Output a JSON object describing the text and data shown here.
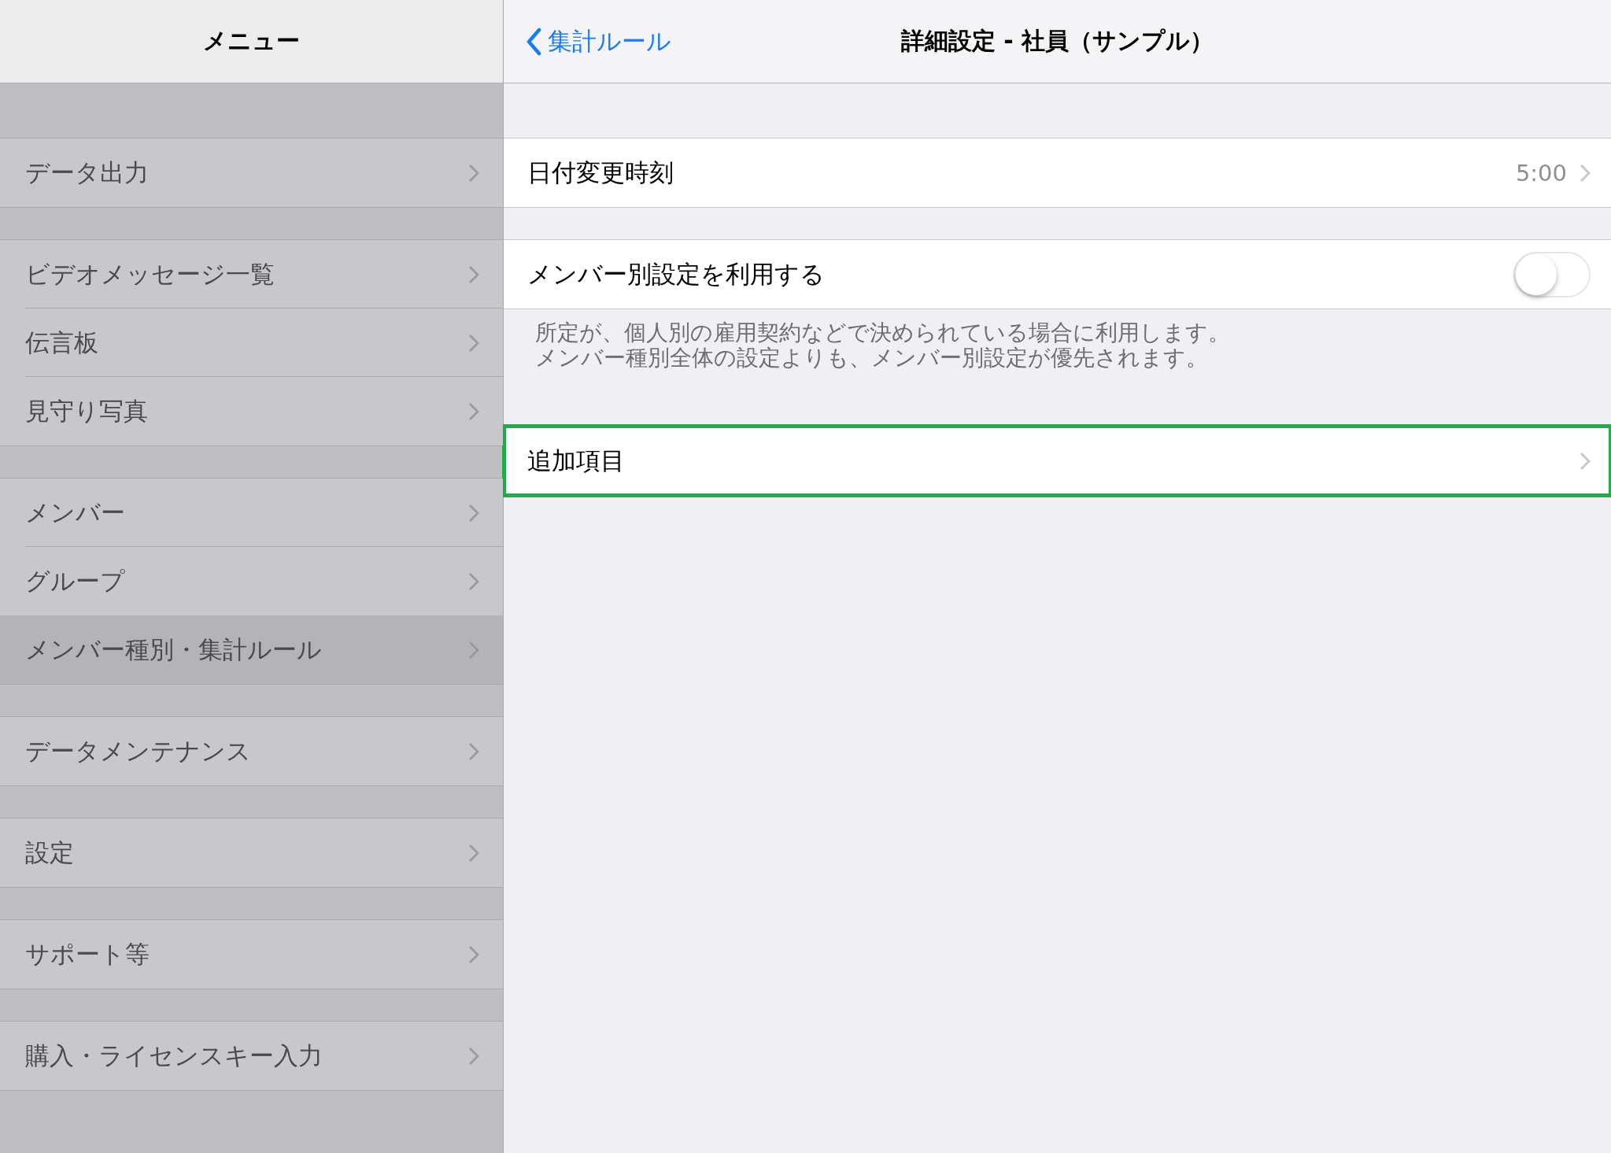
{
  "sidebar": {
    "title": "メニュー",
    "sections": [
      [
        {
          "label": "データ出力",
          "selected": false
        }
      ],
      [
        {
          "label": "ビデオメッセージ一覧",
          "selected": false
        },
        {
          "label": "伝言板",
          "selected": false
        },
        {
          "label": "見守り写真",
          "selected": false
        }
      ],
      [
        {
          "label": "メンバー",
          "selected": false
        },
        {
          "label": "グループ",
          "selected": false
        },
        {
          "label": "メンバー種別・集計ルール",
          "selected": true
        }
      ],
      [
        {
          "label": "データメンテナンス",
          "selected": false
        }
      ],
      [
        {
          "label": "設定",
          "selected": false
        }
      ],
      [
        {
          "label": "サポート等",
          "selected": false
        }
      ],
      [
        {
          "label": "購入・ライセンスキー入力",
          "selected": false
        }
      ]
    ]
  },
  "detail": {
    "back_label": "集計ルール",
    "title": "詳細設定 - 社員（サンプル）",
    "groups": [
      {
        "rows": [
          {
            "kind": "value",
            "label": "日付変更時刻",
            "value": "5:00",
            "highlighted": false
          }
        ]
      },
      {
        "rows": [
          {
            "kind": "toggle",
            "label": "メンバー別設定を利用する",
            "on": false,
            "highlighted": false
          }
        ],
        "footer": [
          "所定が、個人別の雇用契約などで決められている場合に利用します。",
          "メンバー種別全体の設定よりも、メンバー別設定が優先されます。"
        ]
      },
      {
        "rows": [
          {
            "kind": "link",
            "label": "追加項目",
            "highlighted": true
          }
        ]
      }
    ]
  }
}
